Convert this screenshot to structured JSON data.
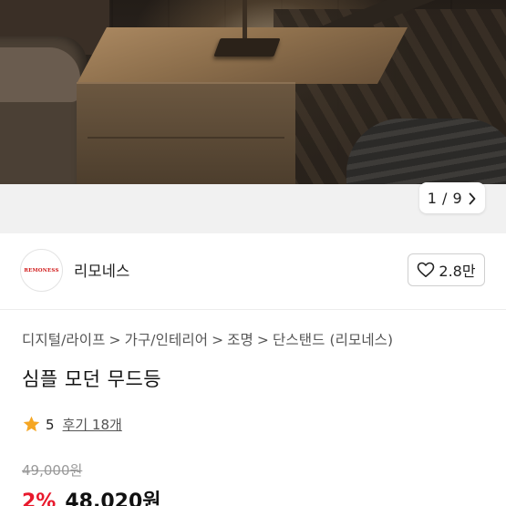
{
  "gallery": {
    "pager_text": "1 / 9",
    "next_icon": "chevron-right-icon"
  },
  "seller": {
    "logo_text": "REMONESS",
    "name": "리모네스",
    "like_icon": "heart-outline-icon",
    "like_count": "2.8만"
  },
  "breadcrumb": {
    "items": [
      "디지털/라이프",
      "가구/인테리어",
      "조명",
      "단스탠드 (리모네스)"
    ],
    "separator": ">"
  },
  "product": {
    "title": "심플 모던 무드등",
    "rating": "5",
    "review_link": "후기 18개",
    "original_price": "49,000원",
    "discount": "2%",
    "final_price": "48,020원"
  },
  "colors": {
    "accent_red": "#e8192c",
    "star_orange": "#f5a623"
  }
}
